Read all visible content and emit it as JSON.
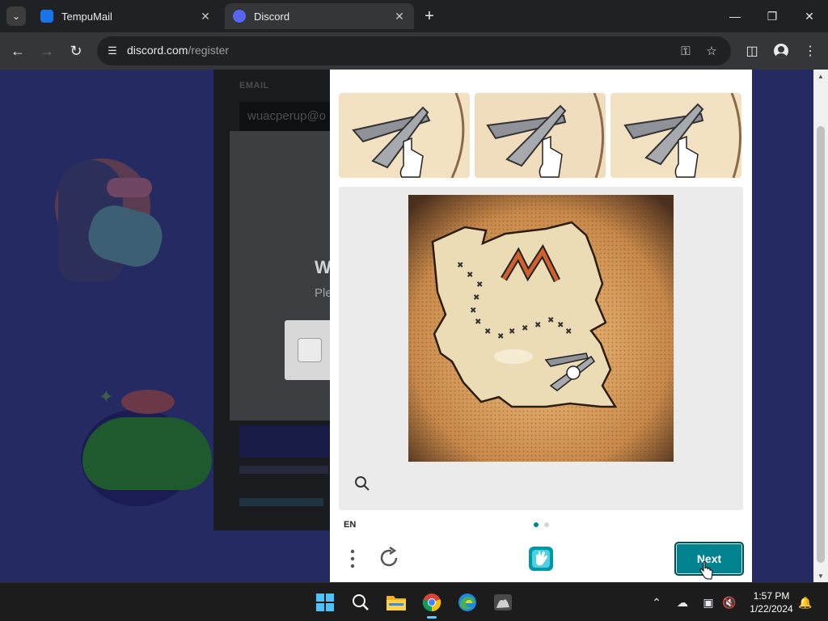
{
  "browser": {
    "tabs": [
      {
        "title": "TempuMail",
        "active": false
      },
      {
        "title": "Discord",
        "active": true
      }
    ],
    "url_host": "discord.com",
    "url_path": "/register"
  },
  "discord": {
    "email_label": "EMAIL",
    "email_value": "wuacperup@o",
    "modal_title_fragment": "W",
    "modal_sub_fragment": "Ple"
  },
  "hcaptcha": {
    "language": "EN",
    "next_label": "Next",
    "pages_total": 2,
    "current_page": 1,
    "colors": {
      "accent": "#00838f",
      "accent_dark": "#004e51"
    }
  },
  "taskbar": {
    "time": "1:57 PM",
    "date": "1/22/2024"
  }
}
